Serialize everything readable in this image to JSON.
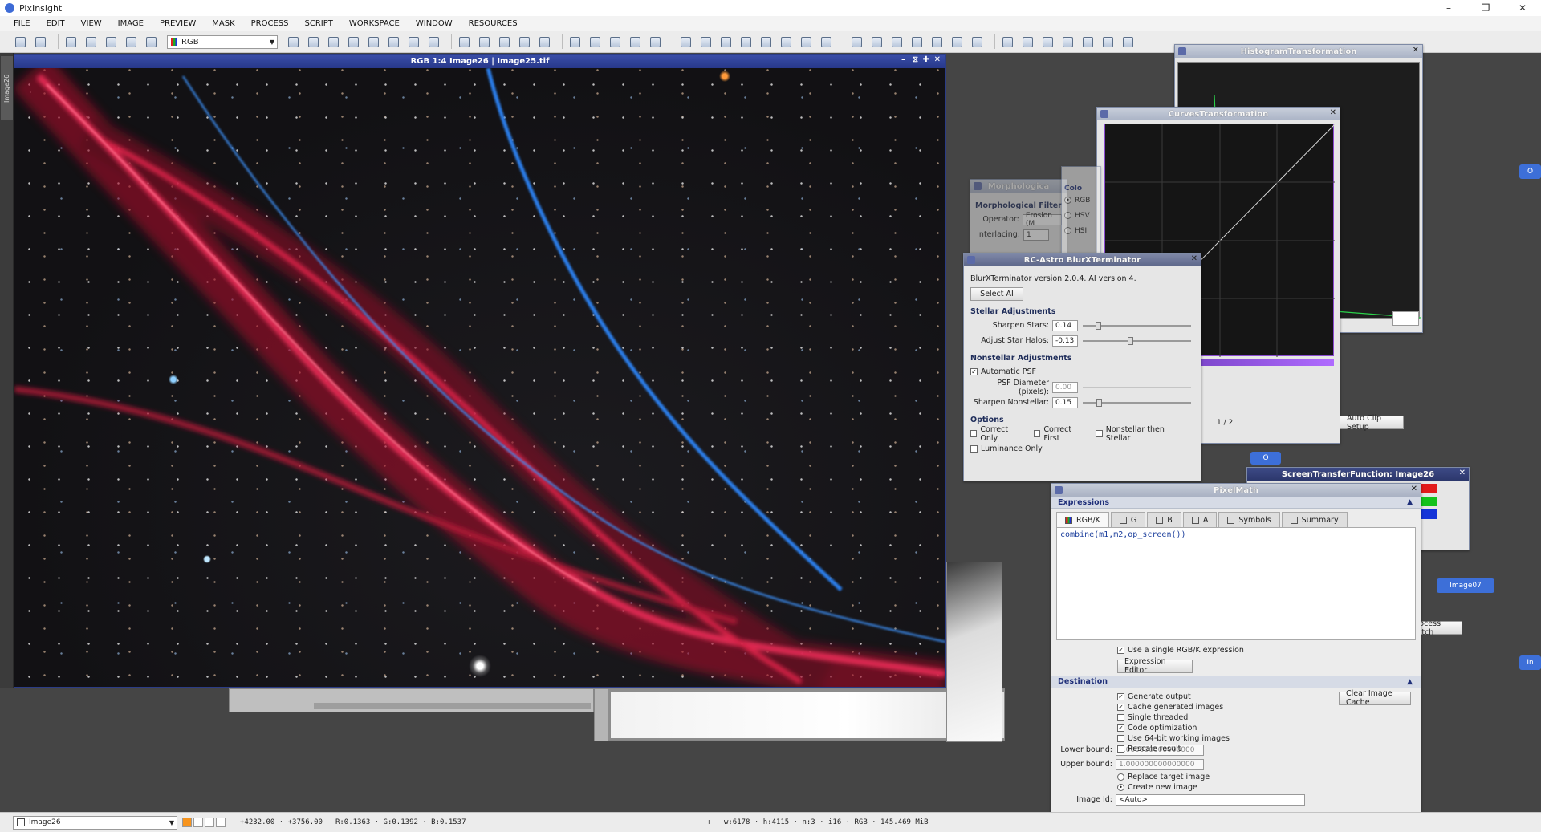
{
  "app": {
    "title": "PixInsight"
  },
  "window_controls": {
    "minimize": "–",
    "maximize": "❐",
    "close": "✕"
  },
  "menu": [
    "FILE",
    "EDIT",
    "VIEW",
    "IMAGE",
    "PREVIEW",
    "MASK",
    "PROCESS",
    "SCRIPT",
    "WORKSPACE",
    "WINDOW",
    "RESOURCES"
  ],
  "toolbar": {
    "color_space": "RGB"
  },
  "image_window": {
    "title": "RGB 1:4 Image26 | Image25.tif",
    "side_tab": "Image26"
  },
  "dialogs": {
    "histogram": "HistogramTransformation",
    "curves": "CurvesTransformation",
    "morphological": "Morphologica",
    "morph_section": "Morphological Filter",
    "morph_operator_label": "Operator:",
    "morph_operator_value": "Erosion (M",
    "morph_interlacing_label": "Interlacing:",
    "morph_interlacing_value": "1",
    "color_space": "Colo",
    "cs_rgb": "RGB",
    "cs_hsv": "HSV",
    "cs_hsi": "HSI",
    "stf": "ScreenTransferFunction: Image26",
    "auto_clip": "Auto Clip Setup",
    "page_count": "1 / 2",
    "process_batch": "Process Batch",
    "image07": "Image07",
    "tag_o": "O",
    "tag_i": "In"
  },
  "blurx": {
    "title": "RC-Astro BlurXTerminator",
    "version": "BlurXTerminator version 2.0.4. AI version 4.",
    "select_ai": "Select AI",
    "stellar_section": "Stellar Adjustments",
    "sharpen_stars_label": "Sharpen Stars:",
    "sharpen_stars": "0.14",
    "sharpen_stars_level": 0.14,
    "halos_label": "Adjust Star Halos:",
    "halos": "-0.13",
    "halos_level": 0.435,
    "nonstellar_section": "Nonstellar Adjustments",
    "auto_psf": "Automatic PSF",
    "psf_label": "PSF Diameter (pixels):",
    "psf": "0.00",
    "sharpen_ns_label": "Sharpen Nonstellar:",
    "sharpen_ns": "0.15",
    "sharpen_ns_level": 0.15,
    "options_section": "Options",
    "correct_only": "Correct Only",
    "correct_first": "Correct First",
    "ns_then_stellar": "Nonstellar then Stellar",
    "luminance_only": "Luminance Only"
  },
  "pixelmath": {
    "title": "PixelMath",
    "expressions_section": "Expressions",
    "tabs": [
      "RGB/K",
      "G",
      "B",
      "A",
      "Symbols",
      "Summary"
    ],
    "expression": "combine(m1,m2,op_screen())",
    "single_expr": "Use a single RGB/K expression",
    "expr_editor": "Expression Editor",
    "destination_section": "Destination",
    "clear_cache": "Clear Image Cache",
    "options": [
      "Generate output",
      "Cache generated images",
      "Single threaded",
      "Code optimization",
      "Use 64-bit working images",
      "Rescale result"
    ],
    "options_checked": [
      true,
      true,
      false,
      true,
      false,
      false
    ],
    "lower_label": "Lower bound:",
    "lower": "0.000000000000000",
    "upper_label": "Upper bound:",
    "upper": "1.000000000000000",
    "replace_target": "Replace target image",
    "create_new": "Create new image",
    "image_id_label": "Image Id:",
    "image_id": "<Auto>"
  },
  "status": {
    "view": "Image26",
    "coords": "+4232.00 · +3756.00",
    "values": "R:0.1363 · G:0.1392 · B:0.1537",
    "info": "w:6178 · h:4115 · n:3 · i16 · RGB · 145.469 MiB"
  }
}
